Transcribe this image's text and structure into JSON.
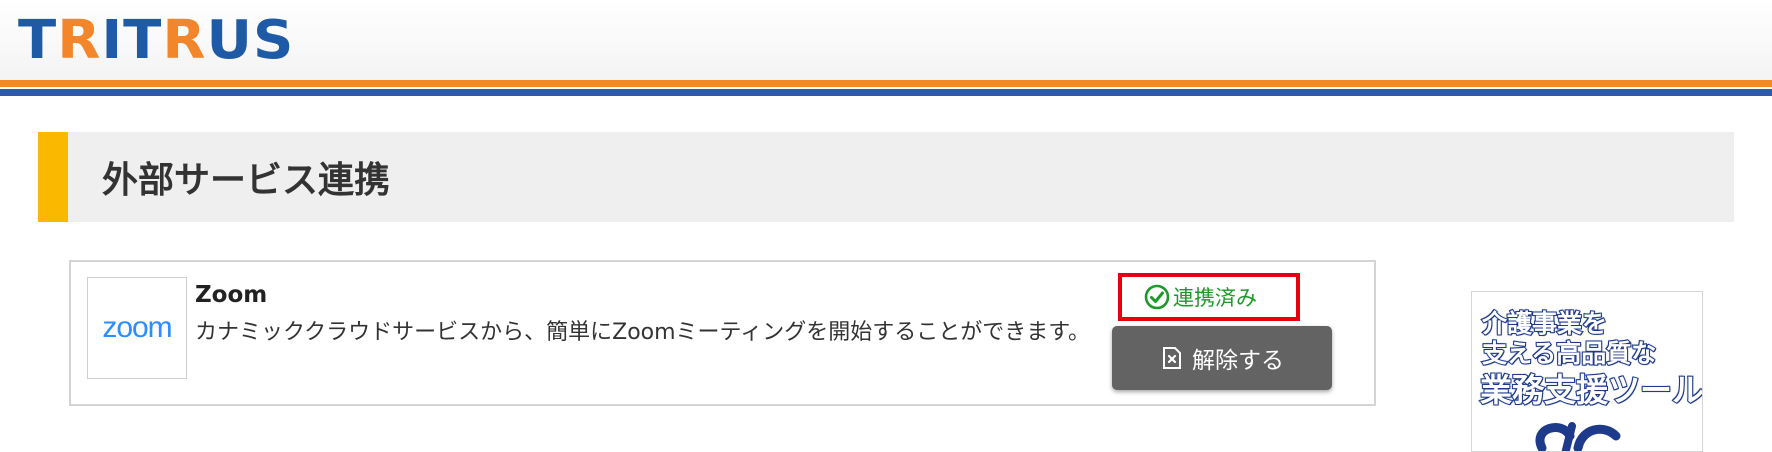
{
  "header": {
    "logo": {
      "parts": [
        {
          "text": "T",
          "color": "#1f5aa6"
        },
        {
          "text": "R",
          "color": "#f3862b"
        },
        {
          "text": "I",
          "color": "#1f5aa6"
        },
        {
          "text": "T",
          "color": "#1f5aa6"
        },
        {
          "text": "R",
          "color": "#f3862b"
        },
        {
          "text": "US",
          "color": "#1f5aa6"
        }
      ]
    },
    "stripe_colors": {
      "orange": "#f5891f",
      "blue": "#2d5ba8"
    }
  },
  "section": {
    "title": "外部サービス連携",
    "accent_color": "#fbb800"
  },
  "services": [
    {
      "logo_text": "zoom",
      "name": "Zoom",
      "description": "カナミッククラウドサービスから、簡単にZoomミーティングを開始することができます。",
      "status_label": "連携済み",
      "status_icon": "check-circle-icon",
      "status_color": "#1b9a2a",
      "unlink_label": "解除する",
      "unlink_icon": "unlink-icon"
    }
  ],
  "ad_banner": {
    "lines": [
      "介護事業を",
      "支える高品質な",
      "業務支援ツール"
    ]
  }
}
